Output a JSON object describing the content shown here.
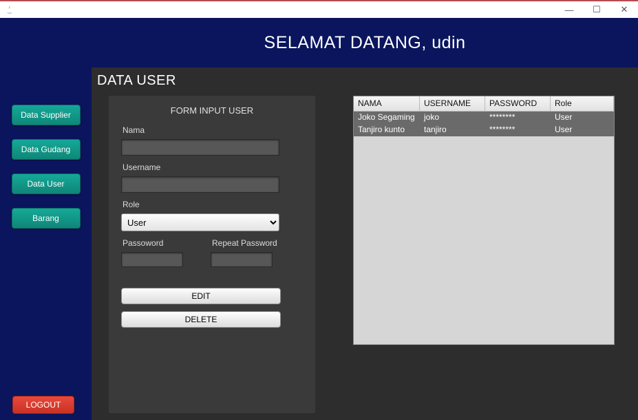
{
  "window": {
    "title": ""
  },
  "header": {
    "welcome": "SELAMAT DATANG, udin"
  },
  "sidebar": {
    "items": [
      {
        "label": "Data Supplier"
      },
      {
        "label": "Data Gudang"
      },
      {
        "label": "Data User"
      },
      {
        "label": "Barang"
      }
    ],
    "logout": "LOGOUT"
  },
  "page": {
    "title": "DATA USER"
  },
  "form": {
    "title": "FORM INPUT USER",
    "nama_label": "Nama",
    "nama_value": "",
    "username_label": "Username",
    "username_value": "",
    "role_label": "Role",
    "role_value": "User",
    "password_label": "Passoword",
    "password_value": "",
    "repeat_label": "Repeat Password",
    "repeat_value": "",
    "edit_label": "EDIT",
    "delete_label": "DELETE"
  },
  "table": {
    "columns": [
      "NAMA",
      "USERNAME",
      "PASSWORD",
      "Role"
    ],
    "rows": [
      {
        "nama": "Joko Segaming",
        "username": "joko",
        "password": "********",
        "role": "User"
      },
      {
        "nama": "Tanjiro kunto",
        "username": "tanjiro",
        "password": "********",
        "role": "User"
      }
    ]
  }
}
